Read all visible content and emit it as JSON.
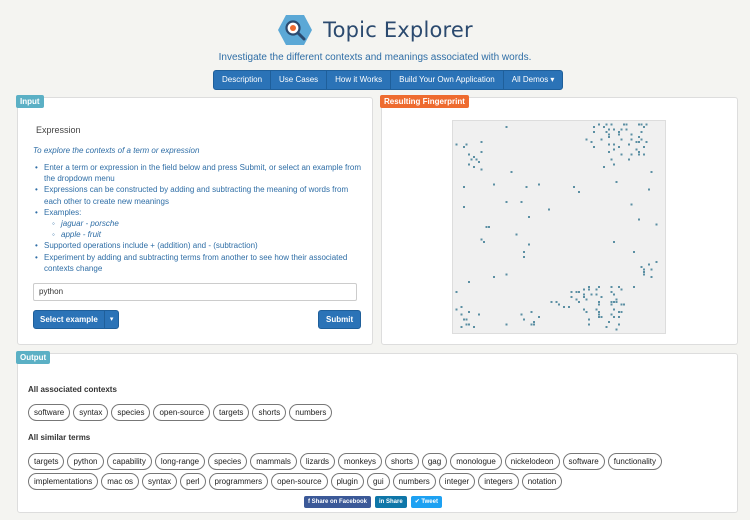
{
  "header": {
    "title": "Topic Explorer",
    "subtitle": "Investigate the different contexts and meanings associated with words."
  },
  "nav": {
    "items": [
      "Description",
      "Use Cases",
      "How it Works",
      "Build Your Own Application",
      "All Demos ▾"
    ]
  },
  "input_panel": {
    "tag": "Input",
    "expression_label": "Expression",
    "explore_heading": "To explore the contexts of a term or expression",
    "instructions": [
      "Enter a term or expression in the field below and press Submit, or select an example from the dropdown menu",
      "Expressions can be constructed by adding and subtracting the meaning of words from each other to create new meanings",
      "Examples:",
      "jaguar - porsche",
      "apple - fruit",
      "Supported operations include + (addition) and - (subtraction)",
      "Experiment by adding and subtracting terms from another to see how their associated contexts change"
    ],
    "expression_value": "python",
    "select_label": "Select example",
    "submit_label": "Submit"
  },
  "fingerprint_panel": {
    "tag": "Resulting Fingerprint",
    "dot_color": "#5b8fa3"
  },
  "output_panel": {
    "tag": "Output",
    "contexts_title": "All associated contexts",
    "contexts": [
      "software",
      "syntax",
      "species",
      "open-source",
      "targets",
      "shorts",
      "numbers"
    ],
    "similar_title": "All similar terms",
    "similar_terms": [
      "targets",
      "python",
      "capability",
      "long-range",
      "species",
      "mammals",
      "lizards",
      "monkeys",
      "shorts",
      "gag",
      "monologue",
      "nickelodeon",
      "software",
      "functionality",
      "implementations",
      "mac os",
      "syntax",
      "perl",
      "programmers",
      "open-source",
      "plugin",
      "gui",
      "numbers",
      "integer",
      "integers",
      "notation"
    ]
  },
  "share": {
    "facebook": "f Share on Facebook",
    "linkedin": "in Share",
    "twitter": "✔ Tweet"
  }
}
